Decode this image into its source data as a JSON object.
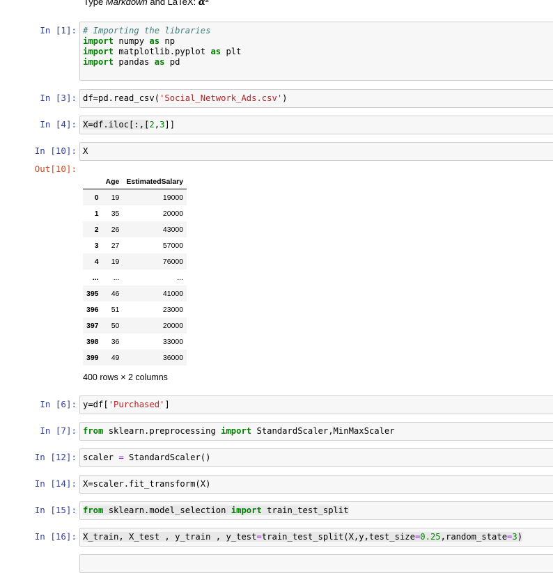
{
  "markdown_tail": {
    "prefix": "Type ",
    "emph": "Markdown",
    "middle": " and LaTeX: ",
    "math": "α²"
  },
  "cells": [
    {
      "prompt": "In [1]:"
    },
    {
      "prompt": "In [3]:"
    },
    {
      "prompt": "In [4]:"
    },
    {
      "prompt": "In [10]:",
      "out_prompt": "Out[10]:"
    },
    {
      "prompt": "In [6]:"
    },
    {
      "prompt": "In [7]:"
    },
    {
      "prompt": "In [12]:"
    },
    {
      "prompt": "In [14]:"
    },
    {
      "prompt": "In [15]:"
    },
    {
      "prompt": "In [16]:"
    }
  ],
  "code": {
    "c1_comment": "# Importing the libraries",
    "c1_l1_kw": "import",
    "c1_l1_mod": " numpy ",
    "c1_l1_as": "as",
    "c1_l1_alias": " np",
    "c1_l2_kw": "import",
    "c1_l2_mod": " matplotlib.pyplot ",
    "c1_l2_as": "as",
    "c1_l2_alias": " plt",
    "c1_l3_kw": "import",
    "c1_l3_mod": " pandas ",
    "c1_l3_as": "as",
    "c1_l3_alias": " pd",
    "c3_a": "df=pd.read_csv(",
    "c3_str": "'Social_Network_Ads.csv'",
    "c3_b": ")",
    "c4_a": "X=df.iloc[:,[",
    "c4_n1": "2",
    "c4_comma": ",",
    "c4_n2": "3",
    "c4_b": "]]",
    "c10": "X",
    "c6_a": "y=df[",
    "c6_str": "'Purchased'",
    "c6_b": "]",
    "c7_from": "from",
    "c7_mod": " sklearn.preprocessing ",
    "c7_import": "import",
    "c7_rest": " StandardScaler,MinMaxScaler",
    "c12_a": "scaler ",
    "c12_eq": "=",
    "c12_b": " StandardScaler()",
    "c14": "X=scaler.fit_transform(X)",
    "c15_from": "from",
    "c15_mod": " sklearn.model_selection ",
    "c15_import": "import",
    "c15_rest": " train_test_split",
    "c16_a": "X_train, X_test , y_train , y_test",
    "c16_eq": "=",
    "c16_b": "train_test_split(X,y,test_size",
    "c16_eq2": "=",
    "c16_n1": "0.25",
    "c16_c": ",random_state",
    "c16_eq3": "=",
    "c16_n2": "3",
    "c16_d": ")"
  },
  "dataframe": {
    "columns": [
      "Age",
      "EstimatedSalary"
    ],
    "rows": [
      {
        "index": "0",
        "age": "19",
        "salary": "19000"
      },
      {
        "index": "1",
        "age": "35",
        "salary": "20000"
      },
      {
        "index": "2",
        "age": "26",
        "salary": "43000"
      },
      {
        "index": "3",
        "age": "27",
        "salary": "57000"
      },
      {
        "index": "4",
        "age": "19",
        "salary": "76000"
      },
      {
        "index": "...",
        "age": "...",
        "salary": "..."
      },
      {
        "index": "395",
        "age": "46",
        "salary": "41000"
      },
      {
        "index": "396",
        "age": "51",
        "salary": "23000"
      },
      {
        "index": "397",
        "age": "50",
        "salary": "20000"
      },
      {
        "index": "398",
        "age": "36",
        "salary": "33000"
      },
      {
        "index": "399",
        "age": "49",
        "salary": "36000"
      }
    ],
    "shape_note": "400 rows × 2 columns"
  }
}
